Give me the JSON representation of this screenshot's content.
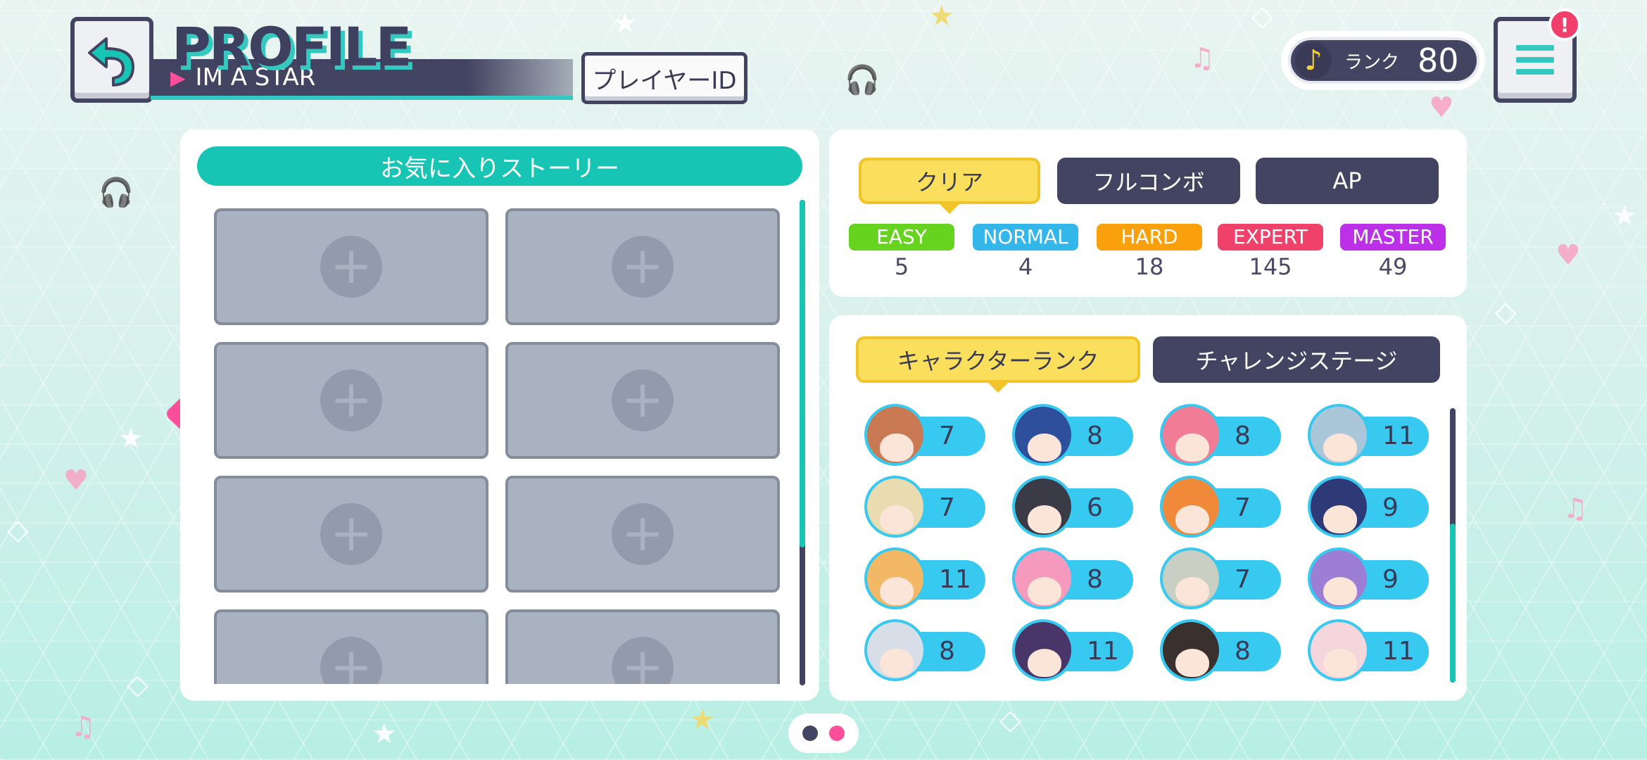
{
  "header": {
    "title": "PROFILE",
    "subtitle": "IM A STAR",
    "player_id_label": "プレイヤーID",
    "rank_label": "ランク",
    "rank_value": "80",
    "alert_badge": "!"
  },
  "icons": {
    "back": "back-arrow-icon",
    "menu": "hamburger-menu-icon",
    "rank": "music-note-icon",
    "prev": "chevron-left-icon",
    "add": "plus-icon"
  },
  "favorite_stories": {
    "title": "お気に入りストーリー",
    "slots": [
      "+",
      "+",
      "+",
      "+",
      "+",
      "+",
      "+",
      "+"
    ]
  },
  "clear_stats": {
    "tabs": [
      "クリア",
      "フルコンボ",
      "AP"
    ],
    "active_tab": "クリア",
    "difficulties": [
      {
        "name": "EASY",
        "count": "5",
        "color": "#66d41e"
      },
      {
        "name": "NORMAL",
        "count": "4",
        "color": "#33b6ea"
      },
      {
        "name": "HARD",
        "count": "18",
        "color": "#f9a00c"
      },
      {
        "name": "EXPERT",
        "count": "145",
        "color": "#ef4169"
      },
      {
        "name": "MASTER",
        "count": "49",
        "color": "#bc31e8"
      }
    ]
  },
  "character_rank": {
    "tabs": [
      "キャラクターランク",
      "チャレンジステージ"
    ],
    "active_tab": "キャラクターランク",
    "rows": [
      [
        {
          "rank": "7",
          "hair": "#c97a52"
        },
        {
          "rank": "8",
          "hair": "#2d4f9c"
        },
        {
          "rank": "8",
          "hair": "#f07d95"
        },
        {
          "rank": "11",
          "hair": "#a9c7d8"
        }
      ],
      [
        {
          "rank": "7",
          "hair": "#e8dcb0"
        },
        {
          "rank": "6",
          "hair": "#3b3b48"
        },
        {
          "rank": "7",
          "hair": "#f08a3a"
        },
        {
          "rank": "9",
          "hair": "#2e3a78"
        }
      ],
      [
        {
          "rank": "11",
          "hair": "#f2b866"
        },
        {
          "rank": "8",
          "hair": "#f59abd"
        },
        {
          "rank": "7",
          "hair": "#c9cfc2"
        },
        {
          "rank": "9",
          "hair": "#9c7fd4"
        }
      ],
      [
        {
          "rank": "8",
          "hair": "#d8dee8"
        },
        {
          "rank": "11",
          "hair": "#4a3568"
        },
        {
          "rank": "8",
          "hair": "#3a302e"
        },
        {
          "rank": "11",
          "hair": "#f4d6dc"
        }
      ]
    ]
  },
  "pagination": {
    "colors": [
      "#434462",
      "#ff4f9a"
    ]
  }
}
